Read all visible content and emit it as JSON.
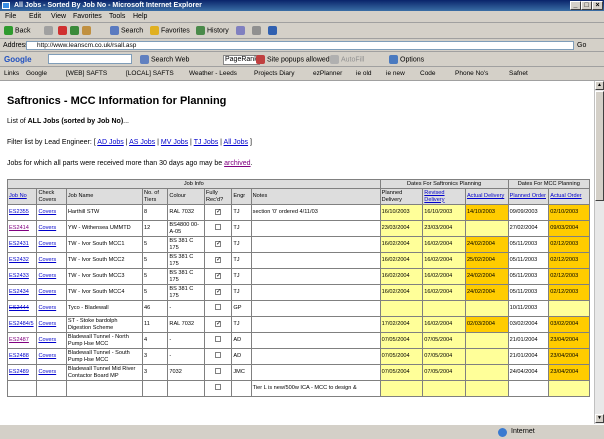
{
  "window": {
    "title": "All Jobs - Sorted By Job No - Microsoft Internet Explorer"
  },
  "menu": [
    "File",
    "Edit",
    "View",
    "Favorites",
    "Tools",
    "Help"
  ],
  "toolbar": {
    "back": "Back",
    "search": "Search",
    "favorites": "Favorites",
    "history": "History"
  },
  "address": {
    "label": "Address",
    "url": "http://www.leanscm.co.uk/rsall.asp",
    "go": "Go"
  },
  "google_bar": {
    "label": "Google",
    "search_web": "Search Web",
    "pagerank": "PageRank",
    "popups": "Site popups allowed",
    "autofill": "AutoFill",
    "options": "Options"
  },
  "links": {
    "label": "Links",
    "items": [
      "Google",
      "[WEB] SAFTS",
      "[LOCAL] SAFTS",
      "Weather - Leeds",
      "Projects Diary",
      "ezPlanner",
      "ie old",
      "ie new",
      "Code",
      "Phone No's",
      "Safnet"
    ]
  },
  "page": {
    "heading": "Saftronics - MCC Information for Planning",
    "list_prefix": "List of ",
    "list_bold": "ALL Jobs (sorted by Job No)",
    "list_suffix": "...",
    "filter_prefix": "Filter list by Lead Engineer: [ ",
    "filters": [
      "AD Jobs",
      "AS Jobs",
      "MV Jobs",
      "TJ Jobs",
      "All Jobs"
    ],
    "filter_suffix": " ]",
    "archived_prefix": "Jobs for which all parts were received more than 30 days ago may be ",
    "archived_link": "archived",
    "archived_suffix": "."
  },
  "table": {
    "group_job_info": "Job Info",
    "group_saftronics": "Dates For Saftronics Planning",
    "group_mcc": "Dates For MCC Planning",
    "headers": [
      "Job No",
      "Check Covers",
      "Job Name",
      "No. of Tiers",
      "Colour",
      "Fully Rec'd?",
      "Engr",
      "Notes",
      "Planned Delivery",
      "Revised Delivery",
      "Actual Delivery",
      "Planned Order",
      "Actual Order"
    ],
    "rows": [
      {
        "job": "ES2355",
        "cov": "Covers",
        "name": "Harthill STW",
        "tiers": "8",
        "colour": "RAL 7032",
        "rec": true,
        "engr": "TJ",
        "notes": "section '0' ordered 4/11/03",
        "pdel": "16/10/2003",
        "rdel": "16/10/2003",
        "adel": "14/10/2003",
        "pord": "09/09/2003",
        "aord": "02/10/2003"
      },
      {
        "job": "ES2414",
        "cov": "Covers",
        "name": "YW - Withensea UMMTD",
        "tiers": "12",
        "colour": "BS4800 00-A-05",
        "rec": false,
        "engr": "TJ",
        "notes": "",
        "pdel": "23/03/2004",
        "rdel": "23/03/2004",
        "adel": "",
        "pord": "27/02/2004",
        "aord": "09/03/2004"
      },
      {
        "job": "ES2431",
        "cov": "Covers",
        "name": "TW - Ivor South MCC1",
        "tiers": "5",
        "colour": "BS 381 C 175",
        "rec": true,
        "engr": "TJ",
        "notes": "",
        "pdel": "16/02/2004",
        "rdel": "16/02/2004",
        "adel": "24/02/2004",
        "pord": "05/11/2003",
        "aord": "02/12/2003"
      },
      {
        "job": "ES2432",
        "cov": "Covers",
        "name": "TW - Ivor South MCC2",
        "tiers": "5",
        "colour": "BS 381 C 175",
        "rec": true,
        "engr": "TJ",
        "notes": "",
        "pdel": "16/02/2004",
        "rdel": "16/02/2004",
        "adel": "25/02/2004",
        "pord": "05/11/2003",
        "aord": "02/12/2003"
      },
      {
        "job": "ES2433",
        "cov": "Covers",
        "name": "TW - Ivor South MCC3",
        "tiers": "5",
        "colour": "BS 381 C 175",
        "rec": true,
        "engr": "TJ",
        "notes": "",
        "pdel": "16/02/2004",
        "rdel": "16/02/2004",
        "adel": "24/02/2004",
        "pord": "05/11/2003",
        "aord": "02/12/2003"
      },
      {
        "job": "ES2434",
        "cov": "Covers",
        "name": "TW - Ivor South MCC4",
        "tiers": "5",
        "colour": "BS 381 C 175",
        "rec": true,
        "engr": "TJ",
        "notes": "",
        "pdel": "16/02/2004",
        "rdel": "16/02/2004",
        "adel": "24/02/2004",
        "pord": "05/11/2003",
        "aord": "02/12/2003"
      },
      {
        "job": "ES2444",
        "cov": "Covers",
        "name": "Tyco - Bladewall",
        "tiers": "46",
        "colour": "-",
        "rec": false,
        "engr": "GP",
        "notes": "",
        "pdel": "",
        "rdel": "",
        "adel": "",
        "pord": "10/11/2003",
        "aord": ""
      },
      {
        "job": "ES2484/5",
        "cov": "Covers",
        "name": "ST - Stoke bardolph Digestion Scheme",
        "tiers": "11",
        "colour": "RAL 7032",
        "rec": true,
        "engr": "TJ",
        "notes": "",
        "pdel": "17/02/2004",
        "rdel": "16/02/2004",
        "adel": "02/03/2004",
        "pord": "03/02/2004",
        "aord": "03/02/2004"
      },
      {
        "job": "ES2487",
        "cov": "Covers",
        "name": "Bladewall Tunnel - North Pump Hse MCC",
        "tiers": "4",
        "colour": "-",
        "rec": false,
        "engr": "AD",
        "notes": "",
        "pdel": "07/05/2004",
        "rdel": "07/05/2004",
        "adel": "",
        "pord": "21/01/2004",
        "aord": "23/04/2004"
      },
      {
        "job": "ES2488",
        "cov": "Covers",
        "name": "Bladewall Tunnel - South Pump Hse MCC",
        "tiers": "3",
        "colour": "-",
        "rec": false,
        "engr": "AD",
        "notes": "",
        "pdel": "07/05/2004",
        "rdel": "07/05/2004",
        "adel": "",
        "pord": "21/01/2004",
        "aord": "23/04/2004"
      },
      {
        "job": "ES2489",
        "cov": "Covers",
        "name": "Bladewall Tunnel Mid River Contactor Board MP",
        "tiers": "3",
        "colour": "7032",
        "rec": false,
        "engr": "JMC",
        "notes": "",
        "pdel": "07/05/2004",
        "rdel": "07/05/2004",
        "adel": "",
        "pord": "24/04/2004",
        "aord": "23/04/2004"
      },
      {
        "job": "",
        "cov": "",
        "name": "",
        "tiers": "",
        "colour": "",
        "rec": false,
        "engr": "",
        "notes": "Tier L is new/500w ICA - MCC to design &",
        "pdel": "",
        "rdel": "",
        "adel": "",
        "pord": "",
        "aord": ""
      }
    ]
  },
  "status": {
    "zone": "Internet"
  }
}
